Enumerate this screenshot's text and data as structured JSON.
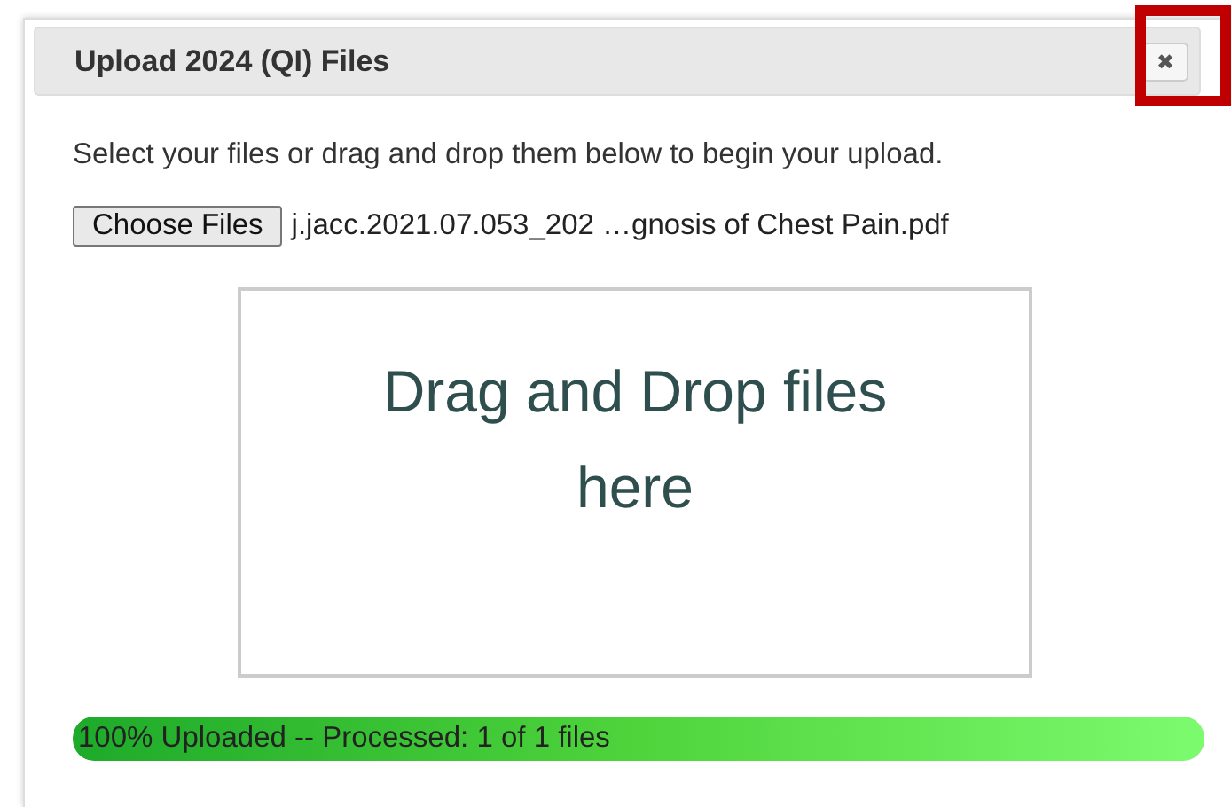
{
  "dialog": {
    "title": "Upload 2024 (QI) Files",
    "close_label": "✖",
    "close_highlighted": true,
    "instructions": "Select your files or drag and drop them below to begin your upload.",
    "choose_button": "Choose Files",
    "file_name": "j.jacc.2021.07.053_202 …gnosis of Chest Pain.pdf",
    "drop_zone": "Drag and Drop files here",
    "progress": {
      "level": 1,
      "text": "100% Uploaded -- Processed: 1 of 1 files"
    }
  }
}
